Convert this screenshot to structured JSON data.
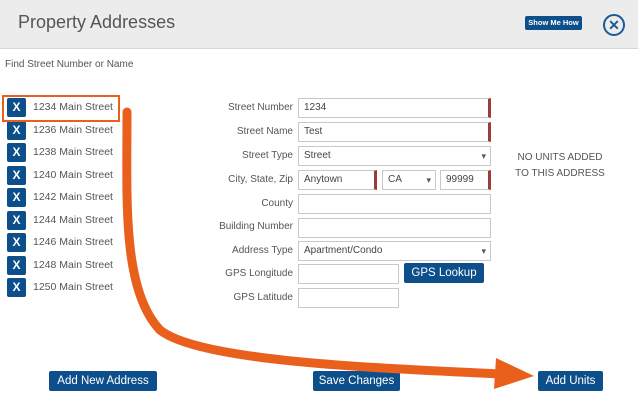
{
  "header": {
    "title": "Property Addresses",
    "show_me_label": "Show Me How",
    "close_symbol": "✕"
  },
  "find_label": "Find Street Number or Name",
  "addresses": [
    {
      "x": "X",
      "label": "1234 Main Street"
    },
    {
      "x": "X",
      "label": "1236 Main Street"
    },
    {
      "x": "X",
      "label": "1238 Main Street"
    },
    {
      "x": "X",
      "label": "1240 Main Street"
    },
    {
      "x": "X",
      "label": "1242 Main Street"
    },
    {
      "x": "X",
      "label": "1244 Main Street"
    },
    {
      "x": "X",
      "label": "1246 Main Street"
    },
    {
      "x": "X",
      "label": "1248 Main Street"
    },
    {
      "x": "X",
      "label": "1250 Main Street"
    }
  ],
  "form": {
    "street_number": {
      "label": "Street Number",
      "value": "1234"
    },
    "street_name": {
      "label": "Street Name",
      "value": "Test"
    },
    "street_type": {
      "label": "Street Type",
      "value": "Street"
    },
    "city_state_zip": {
      "label": "City, State, Zip",
      "city": "Anytown",
      "state": "CA",
      "zip": "99999"
    },
    "county": {
      "label": "County",
      "value": ""
    },
    "building_number": {
      "label": "Building Number",
      "value": ""
    },
    "address_type": {
      "label": "Address Type",
      "value": "Apartment/Condo"
    },
    "gps_longitude": {
      "label": "GPS Longitude",
      "value": ""
    },
    "gps_latitude": {
      "label": "GPS Latitude",
      "value": ""
    },
    "gps_lookup_label": "GPS Lookup"
  },
  "no_units": {
    "line1": "NO UNITS ADDED",
    "line2": "TO THIS ADDRESS"
  },
  "footer": {
    "add_new_address": "Add New Address",
    "save_changes": "Save Changes",
    "add_units": "Add Units"
  },
  "colors": {
    "primary": "#0d4f8b",
    "annotation": "#e8601c",
    "required_marker": "#9e3a3a"
  }
}
